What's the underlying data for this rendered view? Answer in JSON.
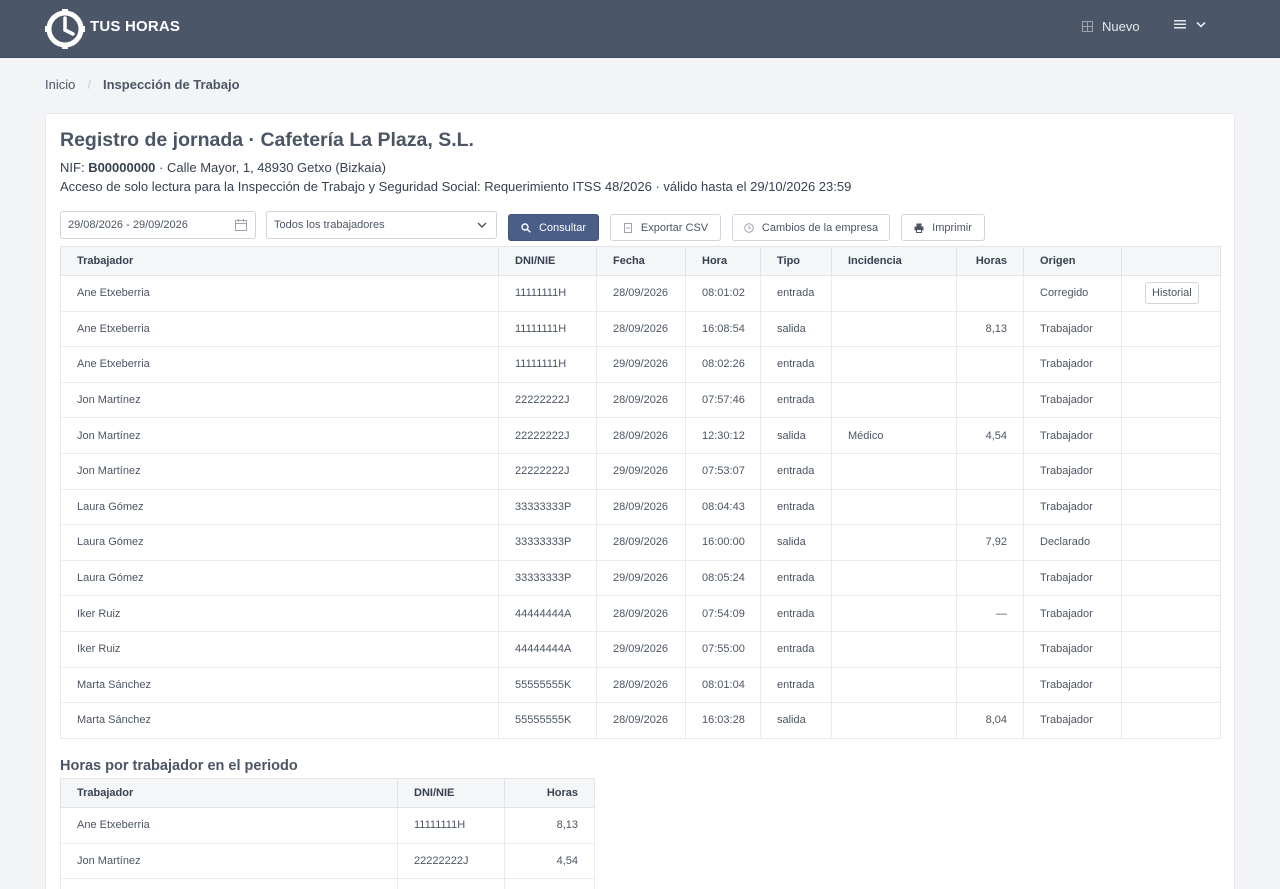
{
  "header": {
    "brand": "TUS HORAS",
    "nuevo_label": "Nuevo",
    "background": "#4b5669"
  },
  "breadcrumb": {
    "home": "Inicio",
    "current": "Inspección de Trabajo"
  },
  "report": {
    "title": "Registro de jornada · Cafetería La Plaza, S.L.",
    "nif_label": "NIF:",
    "nif_value": "B00000000",
    "address": " · Calle Mayor, 1, 48930 Getxo (Bizkaia)",
    "access_note": "Acceso de solo lectura para la Inspección de Trabajo y Seguridad Social: Requerimiento ITSS 48/2026 · válido hasta el 29/10/2026 23:59"
  },
  "filters": {
    "date_range": "29/08/2026 - 29/09/2026",
    "worker_select": "Todos los trabajadores",
    "consultar_label": "Consultar",
    "export_label": "Exportar CSV",
    "cambios_label": "Cambios de la empresa",
    "print_label": "Imprimir",
    "accent": "#4b5e88"
  },
  "table": {
    "headers": [
      "Trabajador",
      "DNI/NIE",
      "Fecha",
      "Hora",
      "Tipo",
      "Incidencia",
      "Horas",
      "Origen",
      ""
    ],
    "history_label": "Historial",
    "rows": [
      {
        "trabajador": "Ane Etxeberria",
        "dni": "11111111H",
        "fecha": "28/09/2026",
        "hora": "08:01:02",
        "tipo": "entrada",
        "incidencia": "",
        "horas": "",
        "origen": "Corregido",
        "historial": true
      },
      {
        "trabajador": "Ane Etxeberria",
        "dni": "11111111H",
        "fecha": "28/09/2026",
        "hora": "16:08:54",
        "tipo": "salida",
        "incidencia": "",
        "horas": "8,13",
        "origen": "Trabajador",
        "historial": false
      },
      {
        "trabajador": "Ane Etxeberria",
        "dni": "11111111H",
        "fecha": "29/09/2026",
        "hora": "08:02:26",
        "tipo": "entrada",
        "incidencia": "",
        "horas": "",
        "origen": "Trabajador",
        "historial": false
      },
      {
        "trabajador": "Jon Martínez",
        "dni": "22222222J",
        "fecha": "28/09/2026",
        "hora": "07:57:46",
        "tipo": "entrada",
        "incidencia": "",
        "horas": "",
        "origen": "Trabajador",
        "historial": false
      },
      {
        "trabajador": "Jon Martínez",
        "dni": "22222222J",
        "fecha": "28/09/2026",
        "hora": "12:30:12",
        "tipo": "salida",
        "incidencia": "Médico",
        "horas": "4,54",
        "origen": "Trabajador",
        "historial": false
      },
      {
        "trabajador": "Jon Martínez",
        "dni": "22222222J",
        "fecha": "29/09/2026",
        "hora": "07:53:07",
        "tipo": "entrada",
        "incidencia": "",
        "horas": "",
        "origen": "Trabajador",
        "historial": false
      },
      {
        "trabajador": "Laura Gómez",
        "dni": "33333333P",
        "fecha": "28/09/2026",
        "hora": "08:04:43",
        "tipo": "entrada",
        "incidencia": "",
        "horas": "",
        "origen": "Trabajador",
        "historial": false
      },
      {
        "trabajador": "Laura Gómez",
        "dni": "33333333P",
        "fecha": "28/09/2026",
        "hora": "16:00:00",
        "tipo": "salida",
        "incidencia": "",
        "horas": "7,92",
        "origen": "Declarado",
        "historial": false
      },
      {
        "trabajador": "Laura Gómez",
        "dni": "33333333P",
        "fecha": "29/09/2026",
        "hora": "08:05:24",
        "tipo": "entrada",
        "incidencia": "",
        "horas": "",
        "origen": "Trabajador",
        "historial": false
      },
      {
        "trabajador": "Iker Ruiz",
        "dni": "44444444A",
        "fecha": "28/09/2026",
        "hora": "07:54:09",
        "tipo": "entrada",
        "incidencia": "",
        "horas": "—",
        "origen": "Trabajador",
        "historial": false
      },
      {
        "trabajador": "Iker Ruiz",
        "dni": "44444444A",
        "fecha": "29/09/2026",
        "hora": "07:55:00",
        "tipo": "entrada",
        "incidencia": "",
        "horas": "",
        "origen": "Trabajador",
        "historial": false
      },
      {
        "trabajador": "Marta Sánchez",
        "dni": "55555555K",
        "fecha": "28/09/2026",
        "hora": "08:01:04",
        "tipo": "entrada",
        "incidencia": "",
        "horas": "",
        "origen": "Trabajador",
        "historial": false
      },
      {
        "trabajador": "Marta Sánchez",
        "dni": "55555555K",
        "fecha": "28/09/2026",
        "hora": "16:03:28",
        "tipo": "salida",
        "incidencia": "",
        "horas": "8,04",
        "origen": "Trabajador",
        "historial": false
      }
    ]
  },
  "summary": {
    "title": "Horas por trabajador en el periodo",
    "headers": [
      "Trabajador",
      "DNI/NIE",
      "Horas"
    ],
    "rows": [
      {
        "trabajador": "Ane Etxeberria",
        "dni": "11111111H",
        "horas": "8,13"
      },
      {
        "trabajador": "Jon Martínez",
        "dni": "22222222J",
        "horas": "4,54"
      },
      {
        "trabajador": "",
        "dni": "",
        "horas": ""
      }
    ]
  }
}
